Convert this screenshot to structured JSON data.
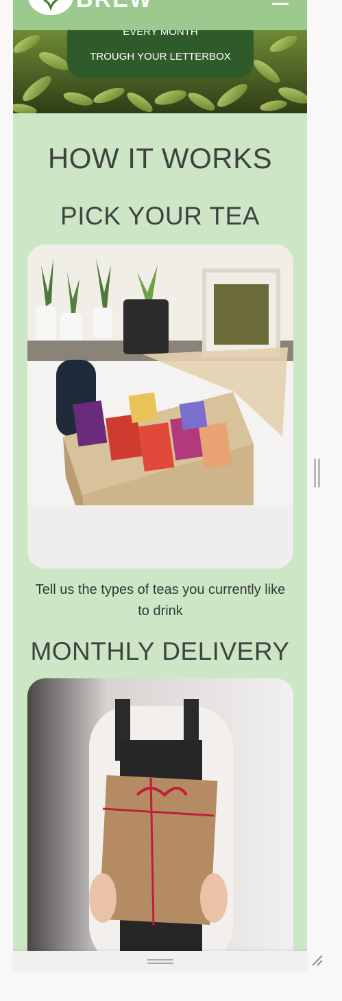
{
  "brand": {
    "name": "BREW"
  },
  "hero": {
    "line1": "EVERY MONTH",
    "line2": "TROUGH YOUR LETTERBOX"
  },
  "how_it_works": {
    "title": "HOW IT WORKS",
    "steps": [
      {
        "title": "PICK YOUR TEA",
        "caption": "Tell us the types of teas you currently like to drink"
      },
      {
        "title": "MONTHLY DELIVERY"
      }
    ]
  },
  "colors": {
    "page_background": "#cde6c6",
    "navbar": "#9cc98d",
    "hero_box": "#2f5b2a",
    "heading_text": "#3f433f"
  },
  "icons": {
    "menu": "hamburger-icon",
    "logo": "tea-leaf-logo",
    "resize": "resize-grip-icon"
  }
}
